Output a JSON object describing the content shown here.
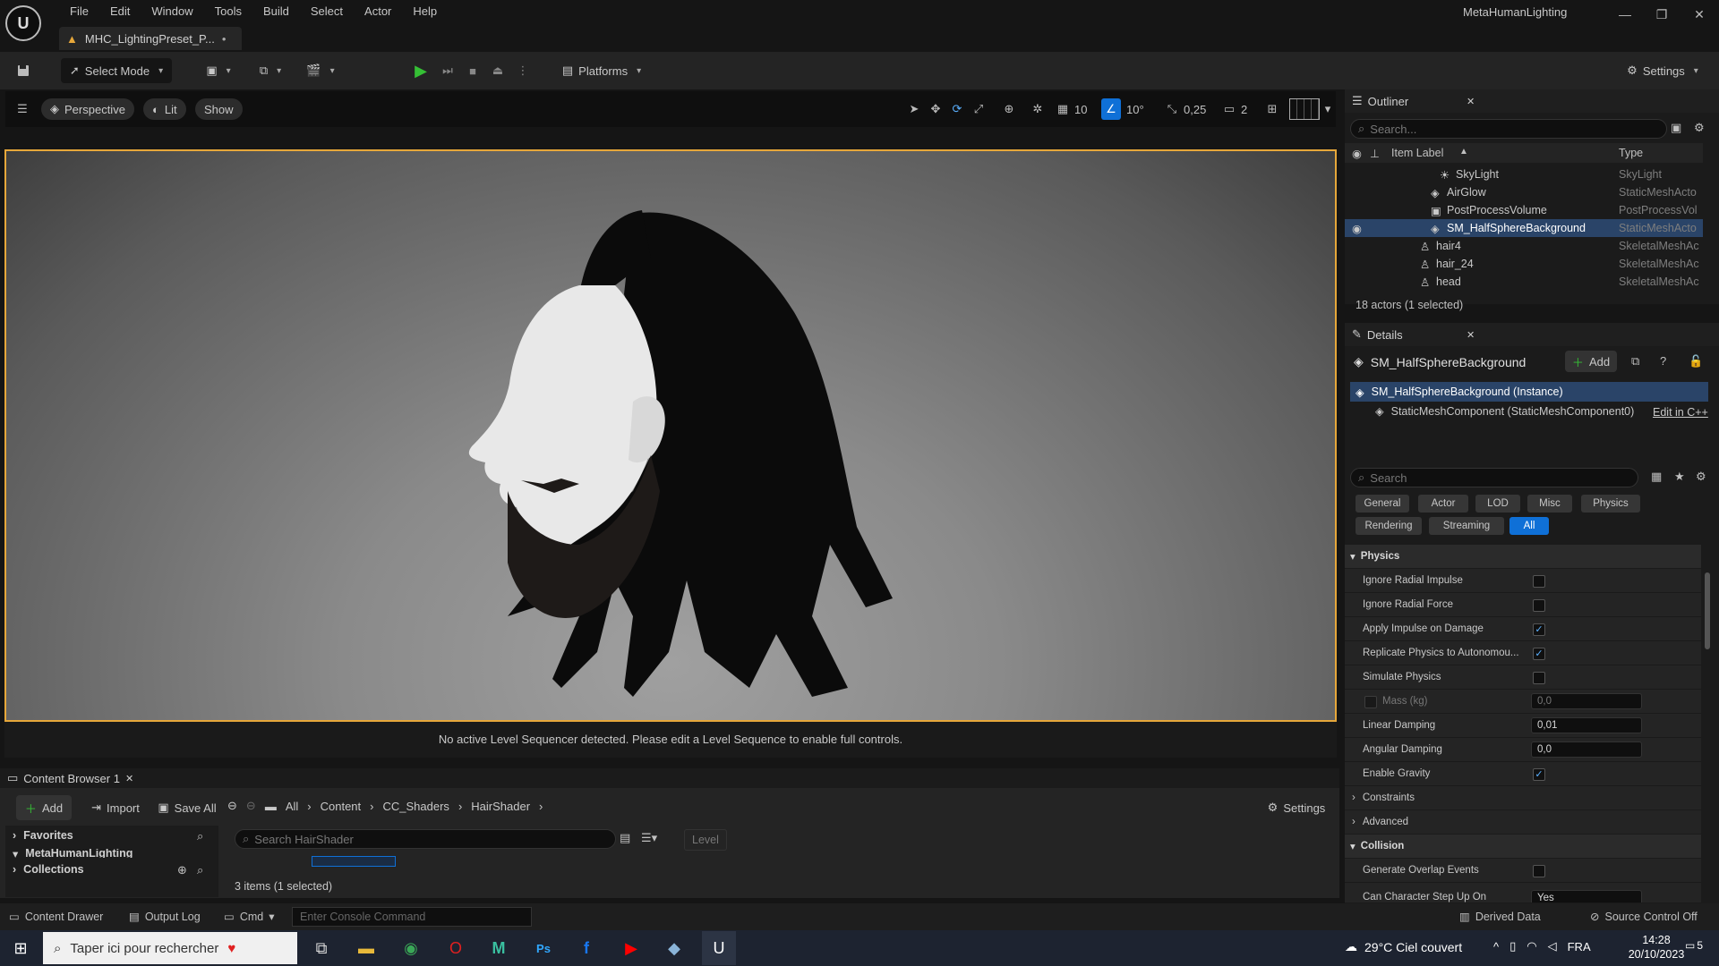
{
  "app": {
    "window_title": "MetaHumanLighting",
    "doc_tab": "MHC_LightingPreset_P...",
    "doc_tab_dirty": "•",
    "menu": [
      "File",
      "Edit",
      "Window",
      "Tools",
      "Build",
      "Select",
      "Actor",
      "Help"
    ]
  },
  "toolbar": {
    "select_mode": "Select Mode",
    "platforms": "Platforms",
    "settings": "Settings"
  },
  "viewport": {
    "perspective": "Perspective",
    "lit": "Lit",
    "show": "Show",
    "grid_snap": "10",
    "rot_snap": "10°",
    "scale_snap": "0,25",
    "camera_speed": "2",
    "sequencer_message": "No active Level Sequencer detected. Please edit a Level Sequence to enable full controls."
  },
  "outliner": {
    "title": "Outliner",
    "search_placeholder": "Search...",
    "col_label": "Item Label",
    "col_type": "Type",
    "items": [
      {
        "label": "SkyLight",
        "type": "SkyLight"
      },
      {
        "label": "AirGlow",
        "type": "StaticMeshActo"
      },
      {
        "label": "PostProcessVolume",
        "type": "PostProcessVol"
      },
      {
        "label": "SM_HalfSphereBackground",
        "type": "StaticMeshActo"
      },
      {
        "label": "hair4",
        "type": "SkeletalMeshAc"
      },
      {
        "label": "hair_24",
        "type": "SkeletalMeshAc"
      },
      {
        "label": "head",
        "type": "SkeletalMeshAc"
      }
    ],
    "count": "18 actors (1 selected)"
  },
  "details": {
    "title": "Details",
    "actor_name": "SM_HalfSphereBackground",
    "add": "Add",
    "instance": "SM_HalfSphereBackground (Instance)",
    "component": "StaticMeshComponent (StaticMeshComponent0)",
    "edit_cpp": "Edit in C++",
    "search_placeholder": "Search",
    "filters_row1": [
      "General",
      "Actor",
      "LOD",
      "Misc",
      "Physics"
    ],
    "filters_row2": [
      "Rendering",
      "Streaming",
      "All"
    ],
    "physics_section": "Physics",
    "props": {
      "ignore_radial_impulse": "Ignore Radial Impulse",
      "ignore_radial_force": "Ignore Radial Force",
      "apply_impulse": "Apply Impulse on Damage",
      "replicate_physics": "Replicate Physics to Autonomou...",
      "simulate_physics": "Simulate Physics",
      "mass": "Mass (kg)",
      "mass_val": "0,0",
      "linear_damping": "Linear Damping",
      "linear_damping_val": "0,01",
      "angular_damping": "Angular Damping",
      "angular_damping_val": "0,0",
      "enable_gravity": "Enable Gravity"
    },
    "constraints": "Constraints",
    "advanced": "Advanced",
    "collision_section": "Collision",
    "generate_overlap": "Generate Overlap Events",
    "can_step_up": "Can Character Step Up On",
    "can_step_up_val": "Yes"
  },
  "content_browser": {
    "tab": "Content Browser 1",
    "add": "Add",
    "import": "Import",
    "save_all": "Save All",
    "path": [
      "All",
      "Content",
      "CC_Shaders",
      "HairShader"
    ],
    "settings": "Settings",
    "favorites": "Favorites",
    "project": "MetaHumanLighting",
    "collections": "Collections",
    "search_placeholder": "Search HairShader",
    "level_filter": "Level",
    "items_count": "3 items (1 selected)"
  },
  "status_bar": {
    "content_drawer": "Content Drawer",
    "output_log": "Output Log",
    "cmd": "Cmd",
    "console_placeholder": "Enter Console Command",
    "derived_data": "Derived Data",
    "source_control": "Source Control Off"
  },
  "taskbar": {
    "search_placeholder": "Taper ici pour rechercher",
    "weather": "29°C  Ciel couvert",
    "lang": "FRA",
    "time": "14:28",
    "date": "20/10/2023",
    "notif_count": "5"
  }
}
